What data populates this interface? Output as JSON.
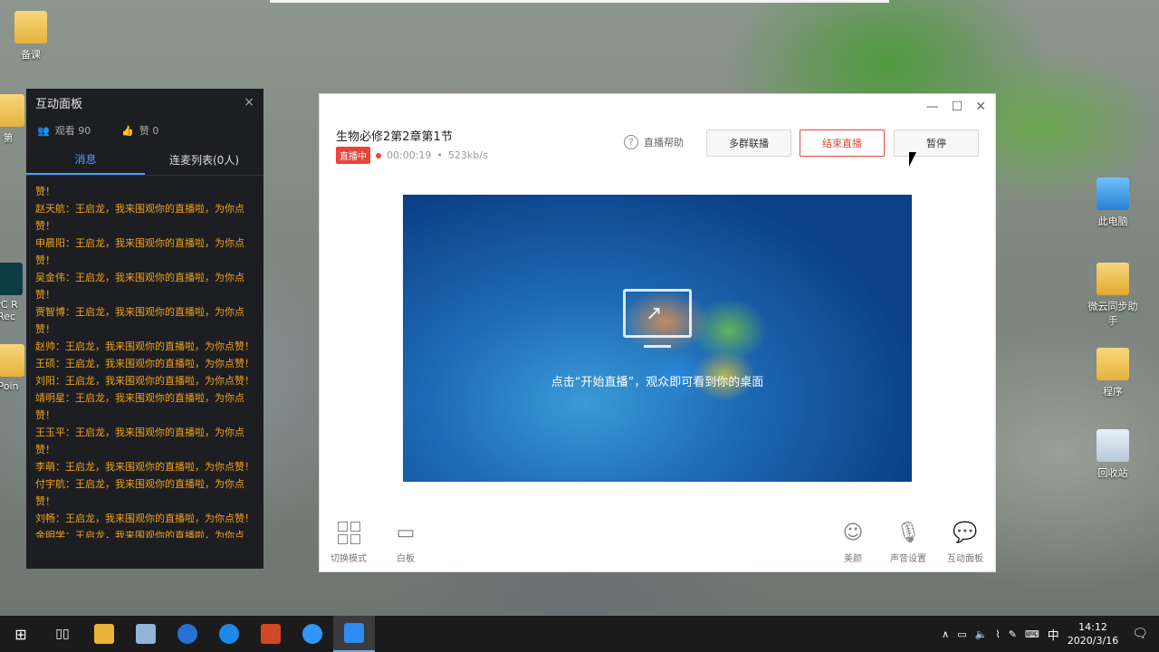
{
  "desktop": {
    "icons_left": [
      {
        "label": "备课"
      },
      {
        "label": "第"
      },
      {
        "label": "PC R"
      },
      {
        "label": "Rec"
      },
      {
        "label": "Poin"
      }
    ],
    "icons_right": [
      {
        "label": "此电脑"
      },
      {
        "label": "微云同步助手"
      },
      {
        "label": "程序"
      },
      {
        "label": "回收站"
      }
    ]
  },
  "panel": {
    "title": "互动面板",
    "close": "×",
    "viewers_label": "观看 90",
    "likes_label": "赞 0",
    "tabs": [
      "消息",
      "连麦列表(0人)"
    ],
    "messages": [
      "赞！",
      "赵天航：王启龙，我来围观你的直播啦，为你点赞！",
      "申晨阳：王启龙，我来围观你的直播啦，为你点赞！",
      "吴金伟：王启龙，我来围观你的直播啦，为你点赞！",
      "贾智博：王启龙，我来围观你的直播啦，为你点赞！",
      "赵帅：王启龙，我来围观你的直播啦，为你点赞！",
      "王硕：王启龙，我来围观你的直播啦，为你点赞！",
      "刘阳：王启龙，我来围观你的直播啦，为你点赞！",
      "靖明星：王启龙，我来围观你的直播啦，为你点赞！",
      "王玉平：王启龙，我来围观你的直播啦，为你点赞！",
      "李萌：王启龙，我来围观你的直播啦，为你点赞！",
      "付宇航：王启龙，我来围观你的直播啦，为你点赞！",
      "刘畅：王启龙，我来围观你的直播啦，为你点赞！",
      "金明学：王启龙，我来围观你的直播啦，为你点赞！"
    ]
  },
  "live": {
    "title": "生物必修2第2章第1节",
    "status_badge": "直播中",
    "duration": "00:00:19",
    "bitrate": "523kb/s",
    "help_label": "直播帮助",
    "buttons": {
      "multi_group": "多群联播",
      "end_live": "结束直播",
      "pause": "暂停"
    },
    "preview_text": "点击“开始直播”，观众即可看到你的桌面",
    "tools_left": [
      "切换模式",
      "白板"
    ],
    "tools_right": [
      "美颜",
      "声音设置",
      "互动面板"
    ]
  },
  "taskbar": {
    "ime": "中",
    "time": "14:12",
    "date": "2020/3/16"
  },
  "colors": {
    "accent_red": "#e9453b",
    "tab_blue": "#4f9bff",
    "message_orange": "#f0a21b"
  }
}
